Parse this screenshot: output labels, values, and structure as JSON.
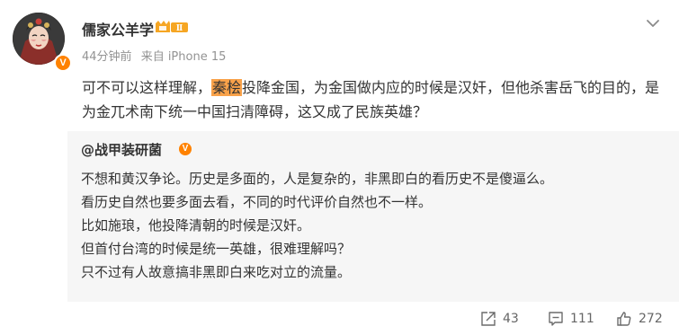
{
  "post": {
    "author": {
      "name": "儒家公羊学",
      "level_badge": "Ⅱ",
      "verified_mark": "V"
    },
    "meta": {
      "time": "44分钟前",
      "source": "来自 iPhone 15"
    },
    "text": {
      "before": "可不可以这样理解，",
      "highlight": "秦桧",
      "after": "投降金国，为金国做内应的时候是汉奸，但他杀害岳飞的目的，是为金兀术南下统一中国扫清障碍，这又成了民族英雄？"
    },
    "repost": {
      "author": "@战甲装研菌",
      "verified_mark": "V",
      "lines": [
        "不想和黄汉争论。历史是多面的，人是复杂的，非黑即白的看历史不是傻逼么。",
        "看历史自然也要多面去看，不同的时代评价自然也不一样。",
        "比如施琅，他投降清朝的时候是汉奸。",
        "但首付台湾的时候是统一英雄，很难理解吗？",
        "只不过有人故意搞非黑即白来吃对立的流量。"
      ]
    },
    "actions": {
      "share_count": "43",
      "comment_count": "111",
      "like_count": "272"
    },
    "colors": {
      "highlight": "#f9a24a",
      "verified": "#ff8200",
      "muted": "#939393"
    }
  }
}
